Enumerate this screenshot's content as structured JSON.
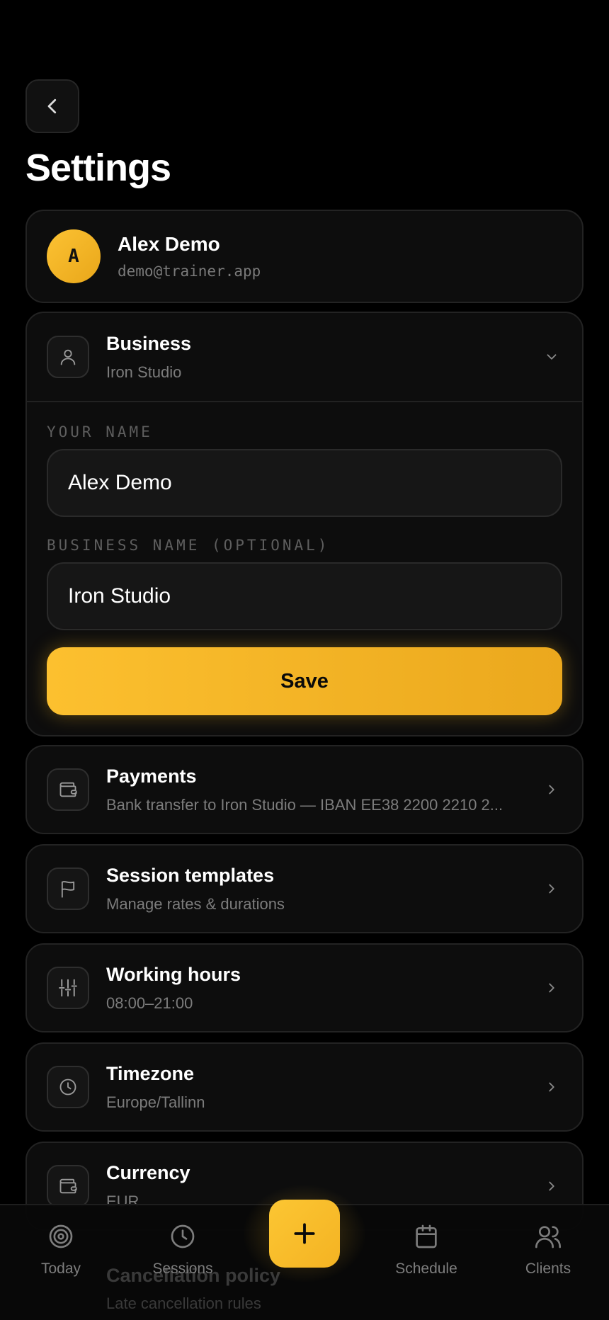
{
  "page": {
    "title": "Settings"
  },
  "profile": {
    "initial": "A",
    "name": "Alex Demo",
    "email": "demo@trainer.app"
  },
  "business": {
    "title": "Business",
    "subtitle": "Iron Studio",
    "name_label": "YOUR NAME",
    "name_value": "Alex Demo",
    "business_label": "BUSINESS NAME (OPTIONAL)",
    "business_value": "Iron Studio",
    "save_label": "Save"
  },
  "rows": {
    "payments": {
      "title": "Payments",
      "subtitle": "Bank transfer to Iron Studio — IBAN EE38 2200 2210 2..."
    },
    "templates": {
      "title": "Session templates",
      "subtitle": "Manage rates & durations"
    },
    "hours": {
      "title": "Working hours",
      "subtitle": "08:00–21:00"
    },
    "timezone": {
      "title": "Timezone",
      "subtitle": "Europe/Tallinn"
    },
    "currency": {
      "title": "Currency",
      "subtitle": "EUR"
    }
  },
  "behind_nav": {
    "title": "Cancellation policy",
    "subtitle": "Late cancellation rules"
  },
  "bottom_nav": {
    "today": "Today",
    "sessions": "Sessions",
    "schedule": "Schedule",
    "clients": "Clients"
  },
  "colors": {
    "accent": "#F8BA28",
    "background": "#000000",
    "card": "#0D0D0D"
  }
}
